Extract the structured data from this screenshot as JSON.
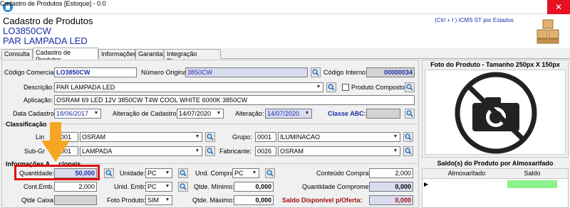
{
  "window": {
    "title": "Cadastro de Produtos [Estoque] - 0.0",
    "close": "✕"
  },
  "header": {
    "main_title": "Cadastro de Produtos",
    "product_code": "LO3850CW",
    "product_desc": "PAR LAMPADA LED",
    "shortcut": "(Ctrl + I ) ICMS ST por Estados"
  },
  "tabs": [
    {
      "label": "Consulta"
    },
    {
      "label": "Cadastro de Produtos"
    },
    {
      "label": "Informações"
    },
    {
      "label": "Garantia"
    },
    {
      "label": "Integração Pluggto"
    }
  ],
  "form": {
    "codigo_comercial": {
      "label": "Código Comercial:",
      "value": "LO3850CW"
    },
    "numero_original": {
      "label": "Número Original:",
      "value": "3850CW"
    },
    "codigo_interno": {
      "label": "Código Interno:",
      "value": "00000034"
    },
    "descricao": {
      "label": "Descrição:",
      "value": "PAR LAMPADA LED"
    },
    "produto_composto": {
      "label": "Produto Composto"
    },
    "aplicacao": {
      "label": "Aplicação:",
      "value": "OSRAM 69 LED 12V 3850CW T4W COOL WHITE 6000K 3850CW"
    },
    "data_cadastro": {
      "label": "Data Cadastro:",
      "value": "18/06/2017"
    },
    "alteracao_cadastro": {
      "label": "Alteração de Cadastro:",
      "value": "14/07/2020"
    },
    "alteracao": {
      "label": "Alteração:",
      "value": "14/07/2020"
    },
    "classe_abc": {
      "label": "Classe ABC:",
      "value": ""
    }
  },
  "classificacao": {
    "title": "Classificação",
    "linha": {
      "label": "Lin",
      "code": "001",
      "name": "OSRAM"
    },
    "grupo": {
      "label": "Grupo:",
      "code": "0001",
      "name": "ILUMINACAO"
    },
    "subgrupo": {
      "label": "Sub-Gr",
      "code": "001",
      "name": "LAMPADA"
    },
    "fabricante": {
      "label": "Fabricante:",
      "code": "0026",
      "name": "OSRAM"
    }
  },
  "informacoes": {
    "title": "Informações A",
    "title_rest": "cionais",
    "quantidade": {
      "label": "Quantidade:",
      "value": "50,000"
    },
    "unidade": {
      "label": "Unidade:",
      "value": "PC"
    },
    "und_compra": {
      "label": "Und. Compra:",
      "value": "PC"
    },
    "conteudo_compra": {
      "label": "Conteúdo Compra:",
      "value": "2,000"
    },
    "cont_emb": {
      "label": "Cont.Emb.:",
      "value": "2,000"
    },
    "unid_emb": {
      "label": "Unid. Emb:",
      "value": "PC"
    },
    "qtde_minimo": {
      "label": "Qtde. Mínimo:",
      "value": "0,000"
    },
    "qtde_comprometido": {
      "label": "Quantidade Comprometido:",
      "value": "0,000"
    },
    "qtde_caixa": {
      "label": "Qtde Caixa:",
      "value": ""
    },
    "foto_produto": {
      "label": "Foto Produto:",
      "value": "SIM"
    },
    "qtde_maximo": {
      "label": "Qtde. Máximo:",
      "value": "0,000"
    },
    "saldo_oferta": {
      "label": "Saldo Disponível p/Oferta:",
      "value": "0,000"
    }
  },
  "photo": {
    "title": "Foto do Produto - Tamanho 250px X 150px",
    "icon": "no-camera-icon"
  },
  "saldo": {
    "title": "Saldo(s) do Produto por Almoxarifado",
    "columns": [
      "Almoxarifado",
      "Saldo"
    ],
    "row_marker": "▶"
  },
  "annotation": {
    "color": "#f5a623",
    "highlight_color": "#e01010"
  }
}
